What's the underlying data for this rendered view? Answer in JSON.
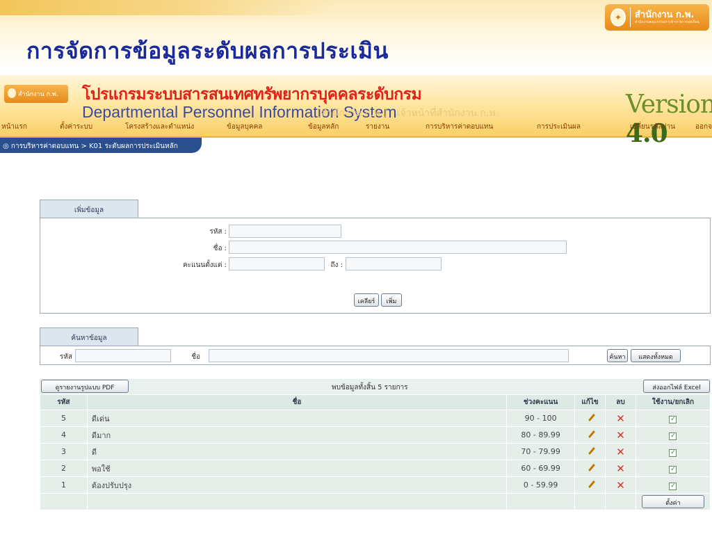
{
  "slide": {
    "title": "การจัดการข้อมูลระดับผลการประเมิน",
    "logo_text": "สำนักงาน ก.พ."
  },
  "banner": {
    "mini_logo": "สำนักงาน ก.พ.",
    "title_th": "โปรแกรมระบบสารสนเทศทรัพยากรบุคคลระดับกรม",
    "title_en": "Departmental Personnel Information System",
    "user": "[สำนักงาน ก.พ.] - เจ้าหน้าที่สำนักงาน ก.พ.",
    "version_word": "Version",
    "version_num": "4.0"
  },
  "menu": {
    "items": [
      "หน้าแรก",
      "ตั้งค่าระบบ",
      "โครงสร้างและตำแหน่ง",
      "ข้อมูลบุคคล",
      "ข้อมูลหลัก",
      "รายงาน",
      "การบริหารค่าตอบแทน",
      "การประเมินผล",
      "เปลี่ยนรหัสผ่าน",
      "ออกจ"
    ]
  },
  "breadcrumb": "◎ การบริหารค่าตอบแทน > K01 ระดับผลการประเมินหลัก",
  "add_form": {
    "tab_label": "เพิ่มข้อมูล",
    "code_label": "รหัส :",
    "name_label": "ชื่อ :",
    "score_from_label": "คะแนนตั้งแต่ :",
    "score_to_label": "ถึง :",
    "clear_btn": "เคลียร์",
    "add_btn": "เพิ่ม"
  },
  "search_form": {
    "tab_label": "ค้นหาข้อมูล",
    "code_label": "รหัส",
    "name_label": "ชื่อ",
    "search_btn": "ค้นหา",
    "show_all_btn": "แสดงทั้งหมด"
  },
  "table": {
    "pdf_btn": "ดูรายงานรูปแบบ PDF",
    "summary": "พบข้อมูลทั้งสิ้น 5 รายการ",
    "excel_btn": "ส่งออกไฟล์ Excel",
    "headers": [
      "รหัส",
      "ชื่อ",
      "ช่วงคะแนน",
      "แก้ไข",
      "ลบ",
      "ใช้งาน/ยกเลิก"
    ],
    "rows": [
      {
        "code": "5",
        "name": "ดีเด่น",
        "range": "90 - 100"
      },
      {
        "code": "4",
        "name": "ดีมาก",
        "range": "80 - 89.99"
      },
      {
        "code": "3",
        "name": "ดี",
        "range": "70 - 79.99"
      },
      {
        "code": "2",
        "name": "พอใช้",
        "range": "60 - 69.99"
      },
      {
        "code": "1",
        "name": "ต้องปรับปรุง",
        "range": "0 - 59.99"
      }
    ],
    "save_btn": "ตั้งค่า"
  }
}
